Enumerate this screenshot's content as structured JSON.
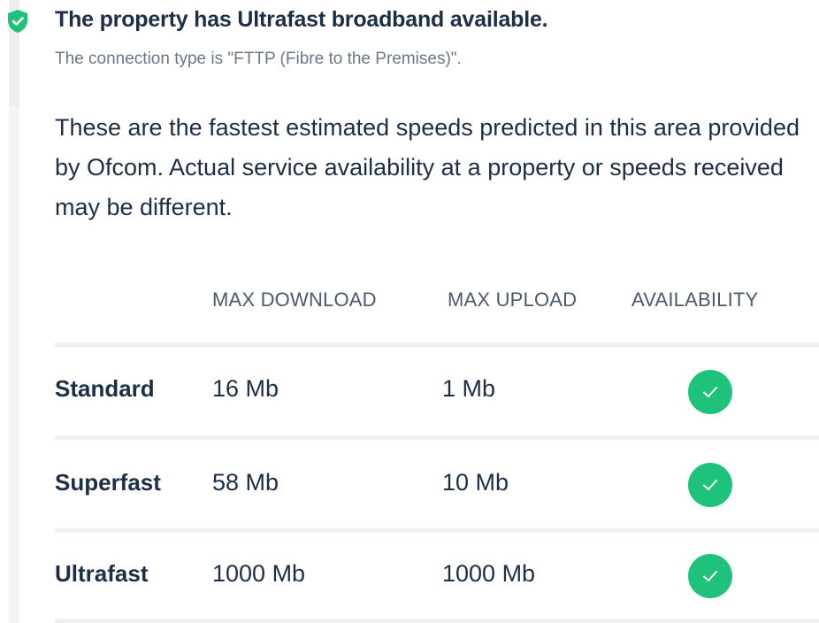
{
  "header": {
    "title": "The property has Ultrafast broadband available.",
    "subtitle": "The connection type is \"FTTP (Fibre to the Premises)\".",
    "icon": "shield-check-icon"
  },
  "description": "These are the fastest estimated speeds predicted in this area provided by Ofcom. Actual service availability at a property or speeds received may be different.",
  "table": {
    "columns": [
      "MAX DOWNLOAD",
      "MAX UPLOAD",
      "AVAILABILITY"
    ],
    "rows": [
      {
        "label": "Standard",
        "download": "16 Mb",
        "upload": "1 Mb",
        "available": true
      },
      {
        "label": "Superfast",
        "download": "58 Mb",
        "upload": "10 Mb",
        "available": true
      },
      {
        "label": "Ultrafast",
        "download": "1000 Mb",
        "upload": "1000 Mb",
        "available": true
      }
    ]
  },
  "colors": {
    "accent_green": "#1fc27a",
    "text_dark": "#1d2f46",
    "text_muted": "#6b7786",
    "divider": "#eef0f2"
  }
}
